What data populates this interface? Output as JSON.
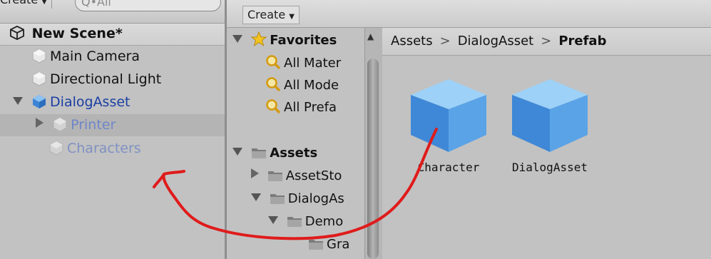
{
  "hierarchy": {
    "create_label": "Create",
    "search_placeholder": "Q•All",
    "scene_label": "New Scene*",
    "items": [
      {
        "label": "Main Camera"
      },
      {
        "label": "Directional Light"
      },
      {
        "label": "DialogAsset"
      },
      {
        "label": "Printer"
      },
      {
        "label": "Characters"
      }
    ]
  },
  "project": {
    "create_label": "Create",
    "tree": {
      "favorites_label": "Favorites",
      "favorites": [
        "All Mater",
        "All Mode",
        "All Prefa"
      ],
      "assets_label": "Assets",
      "assets": [
        "AssetSto",
        "DialogAs",
        "Demo",
        "Gra"
      ]
    },
    "breadcrumb": [
      "Assets",
      "DialogAsset",
      "Prefab"
    ],
    "assets": [
      {
        "label": "Character"
      },
      {
        "label": "DialogAsset"
      }
    ]
  },
  "annotation": {
    "color": "#e01b1b"
  }
}
